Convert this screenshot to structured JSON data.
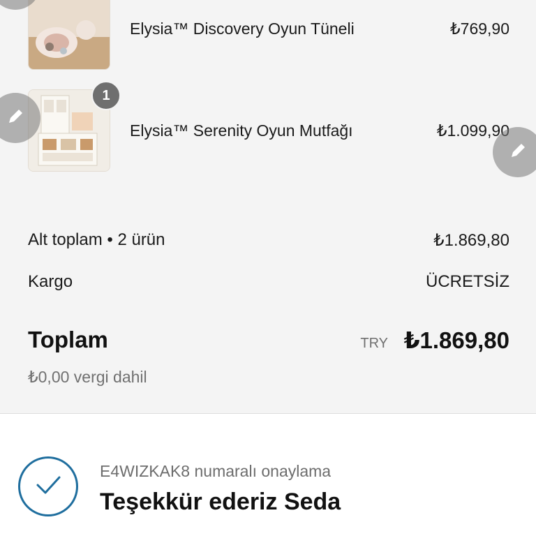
{
  "products": [
    {
      "name": "Elysia™ Discovery Oyun Tüneli",
      "price": "₺769,90"
    },
    {
      "name": "Elysia™ Serenity Oyun Mutfağı",
      "price": "₺1.099,90",
      "quantity": "1"
    }
  ],
  "summary": {
    "subtotal_label": "Alt toplam • 2 ürün",
    "subtotal_value": "₺1.869,80",
    "shipping_label": "Kargo",
    "shipping_value": "ÜCRETSİZ",
    "total_label": "Toplam",
    "currency": "TRY",
    "total_value": "₺1.869,80",
    "tax_note": "₺0,00 vergi dahil"
  },
  "confirmation": {
    "number_text": "E4WIZKAK8 numaralı onaylama",
    "thanks_text": "Teşekkür ederiz Seda"
  },
  "icons": [
    "pencil-icon",
    "checkmark-icon"
  ],
  "colors": {
    "accent": "#1f6e9e",
    "badge": "#6f6f6f",
    "summary_bg": "#f4f4f4"
  }
}
